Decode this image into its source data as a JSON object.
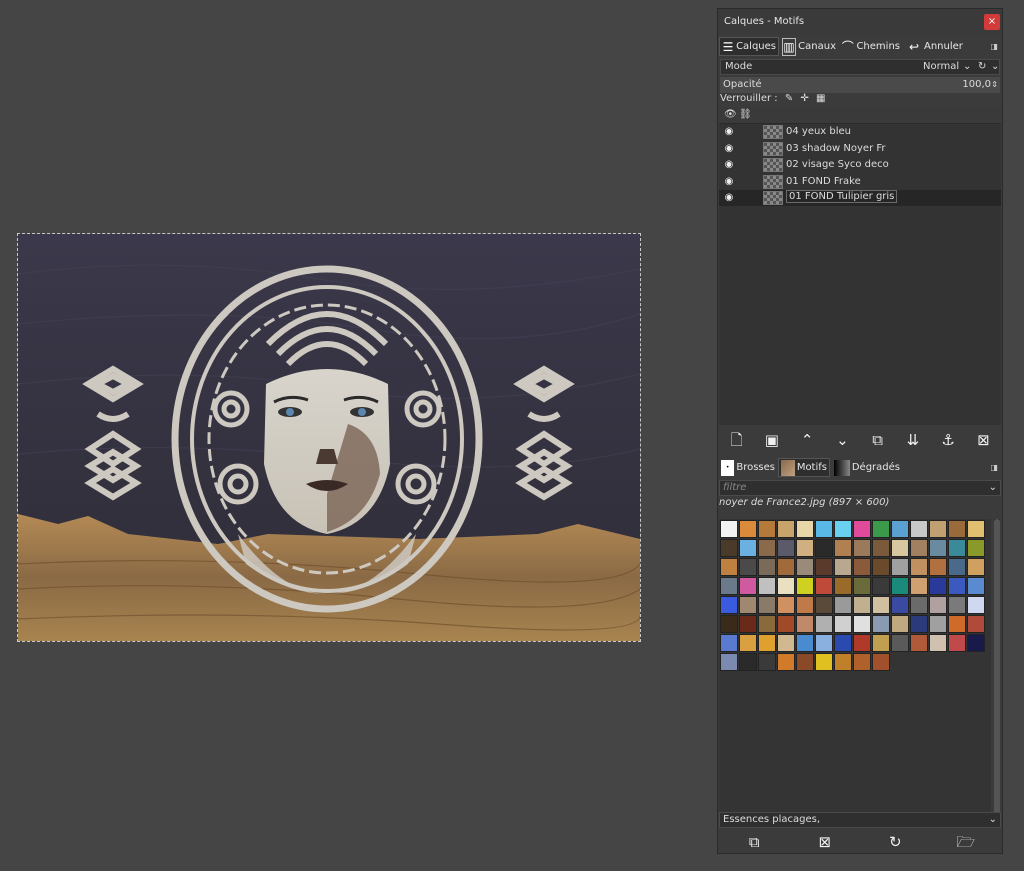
{
  "dock": {
    "title": "Calques - Motifs",
    "close": "×",
    "tabs": [
      {
        "label": "Calques",
        "icon": "layers-icon"
      },
      {
        "label": "Canaux",
        "icon": "channels-icon"
      },
      {
        "label": "Chemins",
        "icon": "paths-icon"
      },
      {
        "label": "Annuler",
        "icon": "undo-icon"
      }
    ],
    "mode_label": "Mode",
    "mode_value": "Normal",
    "opacity_label": "Opacité",
    "opacity_value": "100,0",
    "lock_label": "Verrouiller :",
    "layers": [
      {
        "name": "04 yeux bleu",
        "selected": false
      },
      {
        "name": "03 shadow Noyer Fr",
        "selected": false
      },
      {
        "name": "02 visage Syco deco",
        "selected": false
      },
      {
        "name": "01 FOND Frake",
        "selected": false
      },
      {
        "name": "01 FOND Tulipier gris",
        "selected": true
      }
    ],
    "layer_tools": [
      "new-layer-icon",
      "new-group-icon",
      "raise-layer-icon",
      "lower-layer-icon",
      "duplicate-layer-icon",
      "merge-down-icon",
      "anchor-icon",
      "delete-layer-icon"
    ],
    "resource_tabs": [
      {
        "label": "Brosses",
        "icon": "brush-icon"
      },
      {
        "label": "Motifs",
        "icon": "pattern-icon"
      },
      {
        "label": "Dégradés",
        "icon": "gradient-icon"
      }
    ],
    "filter_placeholder": "filtre",
    "pattern_name": "noyer de France2.jpg (897 × 600)",
    "tag_value": "Essences placages,",
    "resource_tools": [
      "duplicate-pattern-icon",
      "delete-pattern-icon",
      "refresh-icon",
      "open-folder-icon"
    ]
  },
  "patterns": {
    "colors": [
      "#f2f2f2",
      "#d98a3a",
      "#b57a3a",
      "#c8a46a",
      "#e8d5a8",
      "#5ab8e6",
      "#6ad0f0",
      "#e04a9a",
      "#3a9a4a",
      "#5aa0d0",
      "#c8c8c8",
      "#c0a070",
      "#9a6a3a",
      "#e0c070",
      "#4a3a2a",
      "#6ab0e0",
      "#8a6a4a",
      "#5a5a6a",
      "#d0b080",
      "#2a2a2a",
      "#b08050",
      "#9a7a5a",
      "#7a5a3a",
      "#d8c8a0",
      "#a08060",
      "#6a8aa0",
      "#3a8a9a",
      "#8a9a2a",
      "#c08040",
      "#4a4a4a",
      "#7a6a5a",
      "#a06a3a",
      "#9a8a7a",
      "#5a3a2a",
      "#b8a890",
      "#8a5a3a",
      "#6a4a2a",
      "#a0a0a0",
      "#c09060",
      "#b07040",
      "#4a6a8a",
      "#d0a060",
      "#6a7a8a",
      "#d05aa0",
      "#c0c0c0",
      "#e8e0c0",
      "#d0d020",
      "#c04a3a",
      "#9a6a2a",
      "#6a6a3a",
      "#3a3a3a",
      "#1a8a7a",
      "#d0a070",
      "#2a3a9a",
      "#3a5ac0",
      "#5a8ad0",
      "#3a5ae0",
      "#a08870",
      "#8a7a6a",
      "#d09060",
      "#c07a4a",
      "#5a4a3a",
      "#9a9a9a",
      "#c0b090",
      "#d0c0a0",
      "#3a4aa0",
      "#6a6a6a",
      "#b0a0a0",
      "#7a7a7a",
      "#d0d8f0",
      "#3a2a1a",
      "#6a2a1a",
      "#8a6a3a",
      "#a04a2a",
      "#c08a6a",
      "#b0b0b0",
      "#d0d0d0",
      "#e0e0e0",
      "#8a9ab0",
      "#c0a880",
      "#2a3a7a",
      "#a0a0a0",
      "#d06a2a",
      "#b04a3a",
      "#5a7ad0",
      "#d8a040",
      "#e0a030",
      "#d0b890",
      "#4a8ad0",
      "#8ab0e0",
      "#2a4ab0",
      "#b03a2a",
      "#c0a050",
      "#5a5a5a",
      "#b05a3a",
      "#d0c0b0",
      "#c04a4a",
      "#1a1a4a",
      "#7a8ab0",
      "#2a2a2a",
      "#3a3a3a",
      "#d07a2a",
      "#8a4a2a",
      "#e0c020",
      "#c0802a",
      "#b0602a",
      "#a0502a"
    ]
  }
}
